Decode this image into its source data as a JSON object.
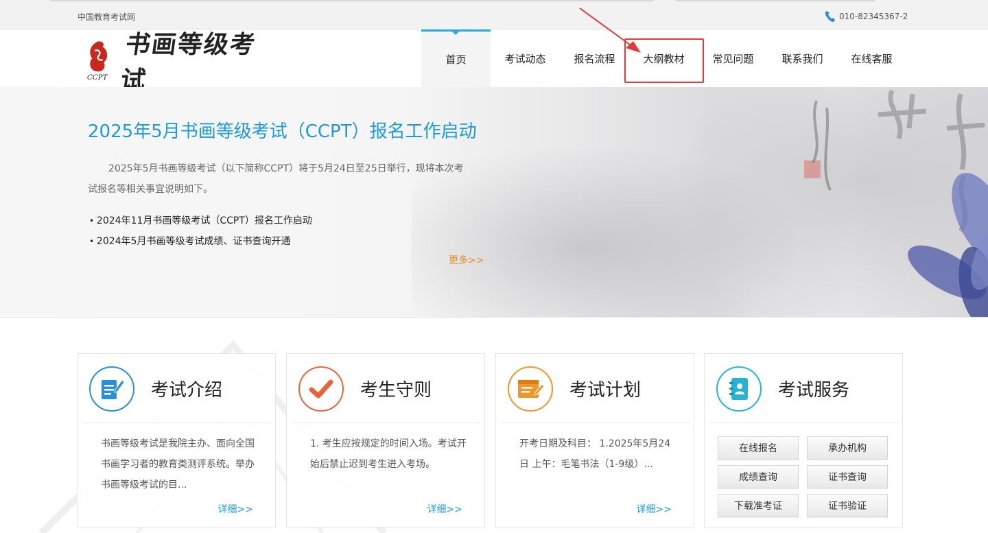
{
  "topbar": {
    "site_name": "中国教育考试网",
    "phone": "010-82345367-2"
  },
  "header": {
    "logo_text": "书画等级考试",
    "logo_sub": "CCPT",
    "nav": [
      {
        "label": "首页"
      },
      {
        "label": "考试动态"
      },
      {
        "label": "报名流程"
      },
      {
        "label": "大纲教材"
      },
      {
        "label": "常见问题"
      },
      {
        "label": "联系我们"
      },
      {
        "label": "在线客服"
      }
    ]
  },
  "banner": {
    "headline": "2025年5月书画等级考试（CCPT）报名工作启动",
    "intro": "2025年5月书画等级考试（以下简称CCPT）将于5月24日至25日举行，现将本次考试报名等相关事宜说明如下。",
    "news": [
      {
        "text": "2024年11月书画等级考试（CCPT）报名工作启动"
      },
      {
        "text": "2024年5月书画等级考试成绩、证书查询开通"
      }
    ],
    "more": "更多>>"
  },
  "cards": [
    {
      "title": "考试介绍",
      "body": "书画等级考试是我院主办、面向全国书画学习者的教育类测评系统。举办书画等级考试的目...",
      "more": "详细>>",
      "color": "#2a8fd6"
    },
    {
      "title": "考生守则",
      "body": "1. 考生应按规定的时间入场。考试开始后禁止迟到考生进入考场。",
      "more": "详细>>",
      "color": "#e8643c"
    },
    {
      "title": "考试计划",
      "body": "开考日期及科目： 1.2025年5月24日 上午：毛笔书法（1-9级）...",
      "more": "详细>>",
      "color": "#f0962a"
    },
    {
      "title": "考试服务",
      "color": "#27b3d6",
      "buttons": [
        {
          "label": "在线报名"
        },
        {
          "label": "承办机构"
        },
        {
          "label": "成绩查询"
        },
        {
          "label": "证书查询"
        },
        {
          "label": "下载准考证"
        },
        {
          "label": "证书验证"
        }
      ]
    }
  ]
}
